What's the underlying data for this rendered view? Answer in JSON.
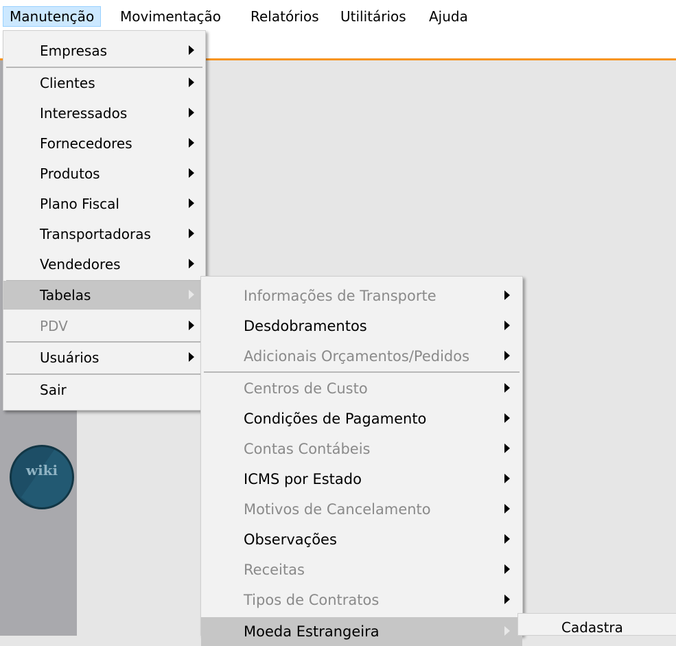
{
  "menubar": {
    "items": [
      "Manutenção",
      "Movimentação",
      "Relatórios",
      "Utilitários",
      "Ajuda"
    ]
  },
  "logo": {
    "text": "wiki"
  },
  "menu_manutencao": {
    "items": [
      {
        "label": "Empresas",
        "submenu": true,
        "disabled": false
      },
      {
        "label": "Clientes",
        "submenu": true,
        "disabled": false
      },
      {
        "label": "Interessados",
        "submenu": true,
        "disabled": false
      },
      {
        "label": "Fornecedores",
        "submenu": true,
        "disabled": false
      },
      {
        "label": "Produtos",
        "submenu": true,
        "disabled": false
      },
      {
        "label": "Plano Fiscal",
        "submenu": true,
        "disabled": false
      },
      {
        "label": "Transportadoras",
        "submenu": true,
        "disabled": false
      },
      {
        "label": "Vendedores",
        "submenu": true,
        "disabled": false
      },
      {
        "label": "Tabelas",
        "submenu": true,
        "disabled": false,
        "highlighted": true
      },
      {
        "label": "PDV",
        "submenu": true,
        "disabled": true
      },
      {
        "label": "Usuários",
        "submenu": true,
        "disabled": false
      },
      {
        "label": "Sair",
        "submenu": false,
        "disabled": false
      }
    ]
  },
  "menu_tabelas": {
    "items": [
      {
        "label": "Informações de Transporte",
        "disabled": true
      },
      {
        "label": "Desdobramentos",
        "disabled": false
      },
      {
        "label": "Adicionais Orçamentos/Pedidos",
        "disabled": true
      },
      {
        "label": "Centros de Custo",
        "disabled": true
      },
      {
        "label": "Condições de Pagamento",
        "disabled": false
      },
      {
        "label": "Contas Contábeis",
        "disabled": true
      },
      {
        "label": "ICMS por Estado",
        "disabled": false
      },
      {
        "label": "Motivos de Cancelamento",
        "disabled": true
      },
      {
        "label": "Observações",
        "disabled": false
      },
      {
        "label": "Receitas",
        "disabled": true
      },
      {
        "label": "Tipos de Contratos",
        "disabled": true
      },
      {
        "label": "Moeda Estrangeira",
        "disabled": false,
        "highlighted": true
      }
    ]
  },
  "menu_moeda": {
    "items": [
      {
        "label": "Cadastra"
      }
    ]
  },
  "colors": {
    "accent_orange": "#f7941e",
    "menubar_active": "#cce8ff",
    "highlight": "#c6c6c6",
    "disabled_text": "#8a8a8a"
  }
}
